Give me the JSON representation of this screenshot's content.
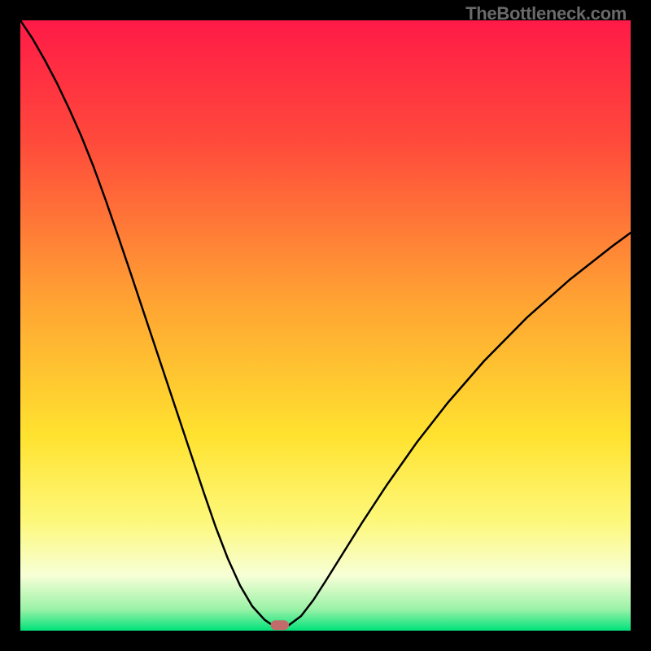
{
  "watermark": "TheBottleneck.com",
  "chart_data": {
    "type": "line",
    "title": "",
    "xlabel": "",
    "ylabel": "",
    "xlim": [
      0,
      100
    ],
    "ylim": [
      0,
      100
    ],
    "grid": false,
    "legend": false,
    "background": {
      "type": "vertical-gradient",
      "stops": [
        {
          "pos": 0.0,
          "color": "#ff1a47"
        },
        {
          "pos": 0.2,
          "color": "#ff4a3b"
        },
        {
          "pos": 0.45,
          "color": "#ffa033"
        },
        {
          "pos": 0.68,
          "color": "#ffe22f"
        },
        {
          "pos": 0.82,
          "color": "#fdf87a"
        },
        {
          "pos": 0.91,
          "color": "#f7ffd6"
        },
        {
          "pos": 0.965,
          "color": "#9af2a7"
        },
        {
          "pos": 1.0,
          "color": "#00e27a"
        }
      ]
    },
    "series": [
      {
        "name": "bottleneck-curve",
        "stroke": "#000000",
        "stroke_width": 2.5,
        "x": [
          0,
          2,
          4,
          6,
          8,
          10,
          12,
          14,
          16,
          18,
          20,
          22,
          24,
          26,
          28,
          30,
          32,
          34,
          36,
          38,
          40,
          41,
          42,
          43,
          44,
          46,
          48,
          50,
          53,
          56,
          60,
          65,
          70,
          76,
          83,
          90,
          97,
          100
        ],
        "y": [
          100,
          97,
          93.5,
          89.7,
          85.5,
          81,
          76,
          70.5,
          64.7,
          58.8,
          52.8,
          46.8,
          40.8,
          34.8,
          28.8,
          22.8,
          17,
          11.8,
          7.4,
          4,
          1.8,
          1.1,
          0.7,
          0.7,
          0.9,
          2.4,
          5,
          8.1,
          12.9,
          17.7,
          23.8,
          30.9,
          37.3,
          44.2,
          51.3,
          57.5,
          63,
          65.2
        ]
      }
    ],
    "marker": {
      "shape": "rounded-rect",
      "x": 42.5,
      "y": 0.9,
      "width": 3.0,
      "height": 1.6,
      "fill": "#c26b6b"
    }
  }
}
